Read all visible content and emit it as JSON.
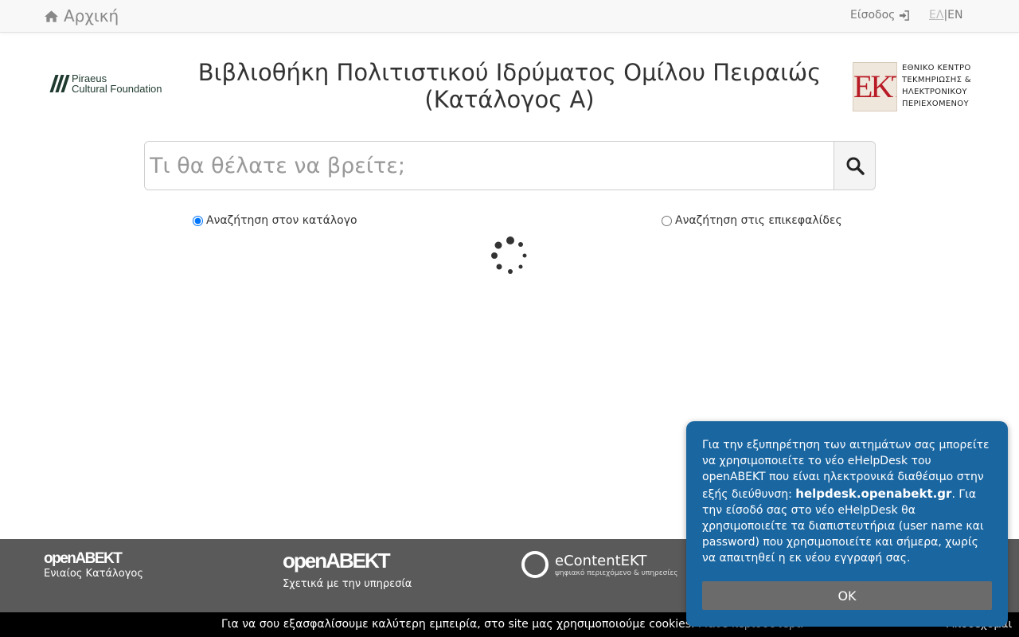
{
  "nav": {
    "home_label": "Αρχική",
    "login_label": "Είσοδος",
    "lang_el": "ΕΛ",
    "lang_sep": "|",
    "lang_en": "EN"
  },
  "header": {
    "title_line1": "Βιβλιοθήκη Πολιτιστικού Ιδρύματος Ομίλου Πειραιώς",
    "title_line2": "(Κατάλογος Α)",
    "left_logo_line1": "Piraeus",
    "left_logo_line2": "Cultural Foundation",
    "ekt_mark": "EKT",
    "ekt_text": [
      "ΕΘΝΙΚΟ ΚΕΝΤΡΟ",
      "ΤΕΚΜΗΡΙΩΣΗΣ &",
      "ΗΛΕΚΤΡΟΝΙΚΟΥ",
      "ΠΕΡΙΕΧΟΜΕΝΟΥ"
    ]
  },
  "search": {
    "placeholder": "Τι θα θέλατε να βρείτε;",
    "value": "",
    "radio_catalog": "Αναζήτηση στον κατάλογο",
    "radio_headings": "Αναζήτηση στις επικεφαλίδες",
    "selected": "catalog"
  },
  "footer": {
    "logo1_name": "openABEKT",
    "logo1_sub": "Ενιαίος Κατάλογος",
    "logo2_name": "openABEKT",
    "logo2_sub": "Σχετικά με την υπηρεσία",
    "logo3_name": "eContentEKT",
    "logo3_sub": "ψηφιακό περιεχόμενο & υπηρεσίες"
  },
  "cookie": {
    "text": "Για να σου εξασφαλίσουμε καλύτερη εμπειρία, στο site μας χρησιμοποιούμε cookies.",
    "more": "Μάθε περισσότερα",
    "accept": "Αποδέχομαι"
  },
  "popup": {
    "text_before": "Για την εξυπηρέτηση των αιτημάτων σας μπορείτε να χρησιμοποιείτε το νέο eHelpDesk του openABEKT που είναι ηλεκτρονικά διαθέσιμο στην εξής διεύθυνση: ",
    "link": "helpdesk.openabekt.gr",
    "text_after": ". Για την είσοδό σας στο νέο eHelpDesk θα χρησιμοποιείτε τα διαπιστευτήρια (user name και password) που χρησιμοποιείτε και σήμερα, χωρίς να απαιτηθεί η εκ νέου εγγραφή σας.",
    "ok_label": "OK"
  },
  "colors": {
    "popup_bg": "#1a66a1",
    "footer_bg": "#5a5a5a",
    "ekt_red": "#b81b25"
  }
}
